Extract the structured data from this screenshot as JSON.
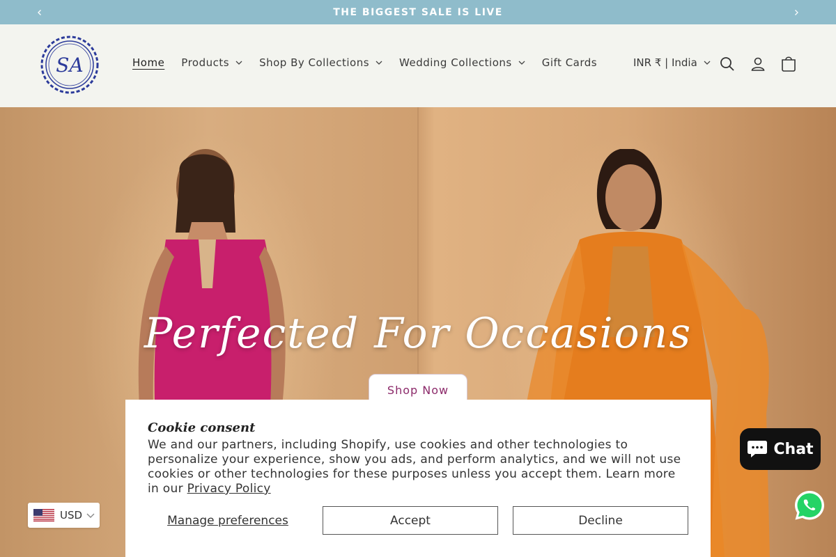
{
  "announcement": {
    "text": "THE BIGGEST SALE IS LIVE",
    "prev_icon": "chevron-left-icon",
    "next_icon": "chevron-right-icon"
  },
  "header": {
    "logo_text": "SA",
    "nav": [
      {
        "label": "Home",
        "active": true
      },
      {
        "label": "Products",
        "dropdown": true
      },
      {
        "label": "Shop By Collections",
        "dropdown": true
      },
      {
        "label": "Wedding Collections",
        "dropdown": true
      },
      {
        "label": "Gift Cards"
      }
    ],
    "country_selector": "INR ₹ | India",
    "icons": [
      "search-icon",
      "account-icon",
      "cart-icon"
    ]
  },
  "hero": {
    "title": "Perfected For Occasions",
    "button_label": "Shop Now"
  },
  "cookie": {
    "title": "Cookie consent",
    "body": "We and our partners, including Shopify, use cookies and other technologies to personalize your experience, show you ads, and perform analytics, and we will not use cookies or other technologies for these purposes unless you accept them. Learn more in our ",
    "privacy_link": "Privacy Policy",
    "manage_label": "Manage preferences",
    "accept_label": "Accept",
    "decline_label": "Decline"
  },
  "currency": {
    "code": "USD",
    "flag_icon": "us-flag-icon"
  },
  "chat": {
    "label": "Chat"
  },
  "colors": {
    "announcement_bg": "#8fbccb",
    "header_bg": "#f3f4ef",
    "logo_blue": "#2b3a9a",
    "shop_now_text": "#8c2a6a",
    "chat_bg": "#111111",
    "whatsapp_green": "#25d366"
  }
}
